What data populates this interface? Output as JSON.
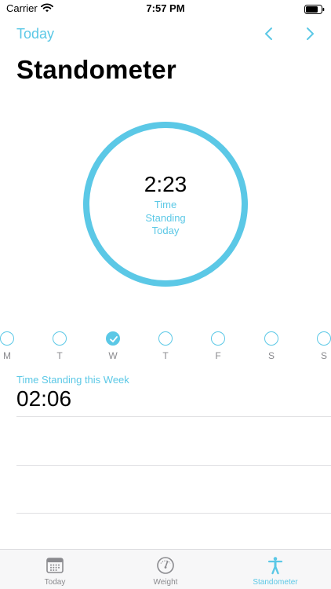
{
  "status_bar": {
    "carrier": "Carrier",
    "time": "7:57 PM"
  },
  "nav": {
    "back_label": "Today",
    "prev_icon": "chevron-left-icon",
    "next_icon": "chevron-right-icon"
  },
  "title": "Standometer",
  "ring": {
    "value": "2:23",
    "label_lines": [
      "Time",
      "Standing",
      "Today"
    ]
  },
  "week_days": [
    {
      "letter": "M",
      "checked": false
    },
    {
      "letter": "T",
      "checked": false
    },
    {
      "letter": "W",
      "checked": true
    },
    {
      "letter": "T",
      "checked": false
    },
    {
      "letter": "F",
      "checked": false
    },
    {
      "letter": "S",
      "checked": false
    },
    {
      "letter": "S",
      "checked": false
    }
  ],
  "week_summary": {
    "label": "Time Standing this Week",
    "value": "02:06"
  },
  "tabs": [
    {
      "label": "Today",
      "icon": "calendar-icon",
      "active": false
    },
    {
      "label": "Weight",
      "icon": "scale-icon",
      "active": false
    },
    {
      "label": "Standometer",
      "icon": "person-standing-icon",
      "active": true
    }
  ],
  "colors": {
    "accent": "#5bc8e6",
    "secondary_text": "#8a8a8e",
    "divider": "#e0e0e3"
  }
}
